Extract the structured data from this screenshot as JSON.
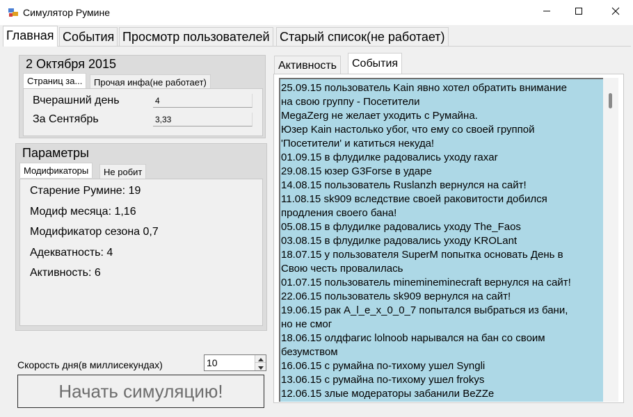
{
  "window": {
    "title": "Симулятор Румине"
  },
  "main_tabs": [
    {
      "label": "Главная"
    },
    {
      "label": "События"
    },
    {
      "label": "Просмотр пользователей"
    },
    {
      "label": "Старый список(не работает)"
    }
  ],
  "date_group": {
    "title": "2 Октября 2015",
    "tabs": [
      {
        "label": "Страниц за..."
      },
      {
        "label": "Прочая инфа(не работает)"
      }
    ],
    "rows": [
      {
        "label": "Вчерашний день",
        "value": "4"
      },
      {
        "label": "За Сентябрь",
        "value": "3,33"
      }
    ]
  },
  "params_group": {
    "title": "Параметры",
    "tabs": [
      {
        "label": "Модификаторы"
      },
      {
        "label": "Не робит"
      }
    ],
    "items": [
      "Старение Румине: 19",
      "Модиф месяца: 1,16",
      "Модификатор сезона 0,7",
      "Адекватность: 4",
      "Активность: 6"
    ]
  },
  "right_tabs": [
    {
      "label": "Активность"
    },
    {
      "label": "События"
    }
  ],
  "events": [
    "25.09.15 пользователь Kain явно хотел обратить внимание",
    "на свою группу - Посетители",
    "MegaZerg не желает уходить с Румайна.",
    "Юзер Kain настолько убог, что ему со своей группой",
    "'Посетители' и катиться некуда!",
    "01.09.15 в флудилке радовались уходу raxar",
    "29.08.15 юзер G3Forse в ударе",
    "14.08.15 пользователь Ruslanzh вернулся на сайт!",
    "11.08.15 sk909 вследствие своей раковитости добился",
    "продления своего бана!",
    "05.08.15 в флудилке радовались уходу The_Faos",
    "03.08.15 в флудилке радовались уходу KROLant",
    "18.07.15 у пользователя SuperM попытка основать День в",
    "Свою честь провалилась",
    "01.07.15 пользователь minemineminecraft вернулся на сайт!",
    "22.06.15 пользователь sk909 вернулся на сайт!",
    "19.06.15 рак A_l_e_x_0_0_7 попытался выбраться из бани,",
    "но не смог",
    "18.06.15 олдфагис lolnoob нарывался на бан со своим",
    "безумством",
    "16.06.15 с румайна по-тихому ушел Syngli",
    "13.06.15 с румайна по-тихому ушел frokys",
    "12.06.15 злые модераторы забанили BeZZe"
  ],
  "speed": {
    "label": "Скорость дня(в миллисекундах)",
    "value": "10"
  },
  "start_button": {
    "label": "Начать симуляцию!"
  },
  "icons": {
    "app": "app-icon",
    "minimize": "minimize-icon",
    "maximize": "maximize-icon",
    "close": "close-icon"
  }
}
